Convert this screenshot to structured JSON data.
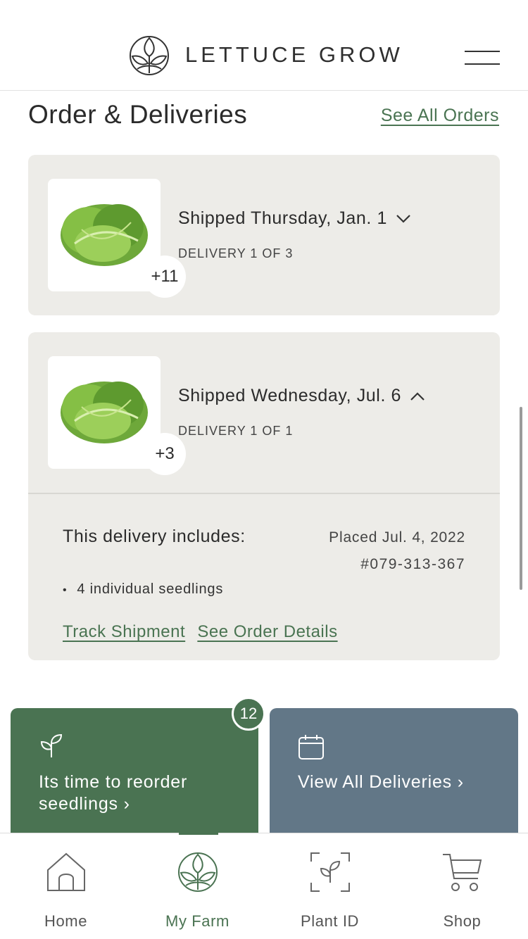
{
  "header": {
    "brand": "LETTUCE GROW",
    "logo_icon": "leaf-circle-logo-icon",
    "menu_icon": "hamburger-menu-icon"
  },
  "orders": {
    "title": "Order & Deliveries",
    "see_all_label": "See All Orders",
    "deliveries": [
      {
        "shipped": "Shipped Thursday, Jan. 1",
        "delivery_count": "DELIVERY 1 OF 3",
        "extra_items": "+11",
        "expanded": false
      },
      {
        "shipped": "Shipped Wednesday, Jul. 6",
        "delivery_count": "DELIVERY 1 OF 1",
        "extra_items": "+3",
        "expanded": true,
        "includes_label": "This delivery includes:",
        "placed": "Placed Jul. 4, 2022",
        "order_number": "#079-313-367",
        "items": [
          "4 individual seedlings"
        ],
        "track_label": "Track Shipment",
        "details_label": "See Order Details"
      }
    ]
  },
  "tiles": {
    "reorder": {
      "text": "Its time to reorder seedlings ›",
      "badge": "12",
      "icon": "seedling-icon"
    },
    "deliveries": {
      "text": "View All Deliveries ›",
      "icon": "calendar-icon"
    }
  },
  "nav": {
    "items": [
      {
        "label": "Home",
        "icon": "home-icon"
      },
      {
        "label": "My Farm",
        "icon": "farm-logo-icon",
        "active": true
      },
      {
        "label": "Plant ID",
        "icon": "plant-scan-icon"
      },
      {
        "label": "Shop",
        "icon": "cart-icon"
      }
    ]
  },
  "colors": {
    "accent_green": "#4a7352",
    "slate_blue": "#627787",
    "card_bg": "#edece8"
  }
}
